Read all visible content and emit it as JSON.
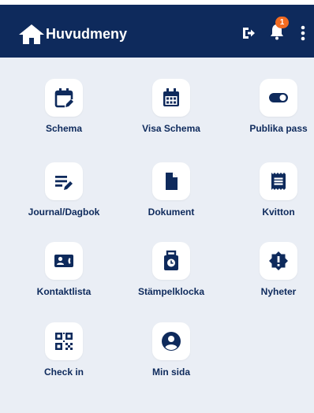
{
  "header": {
    "title": "Huvudmeny",
    "notification_count": "1",
    "icons": {
      "home": "home-icon",
      "logout": "logout-icon",
      "bell": "bell-icon",
      "more": "more-vertical-icon"
    }
  },
  "colors": {
    "header_bg": "#0e2a5c",
    "page_bg": "#eaeef5",
    "icon": "#0e2a5c",
    "badge": "#f26b21"
  },
  "menu": {
    "items": [
      {
        "label": "Schema",
        "icon": "calendar-edit-icon"
      },
      {
        "label": "Visa Schema",
        "icon": "calendar-grid-icon"
      },
      {
        "label": "Publika pass",
        "icon": "toggle-icon"
      },
      {
        "label": "Journal/Dagbok",
        "icon": "edit-note-icon"
      },
      {
        "label": "Dokument",
        "icon": "document-icon"
      },
      {
        "label": "Kvitton",
        "icon": "receipt-icon"
      },
      {
        "label": "Kontaktlista",
        "icon": "contact-card-icon"
      },
      {
        "label": "Stämpelklocka",
        "icon": "punch-clock-icon"
      },
      {
        "label": "Nyheter",
        "icon": "news-alert-icon"
      },
      {
        "label": "Check in",
        "icon": "qr-code-icon"
      },
      {
        "label": "Min sida",
        "icon": "account-circle-icon"
      }
    ]
  }
}
